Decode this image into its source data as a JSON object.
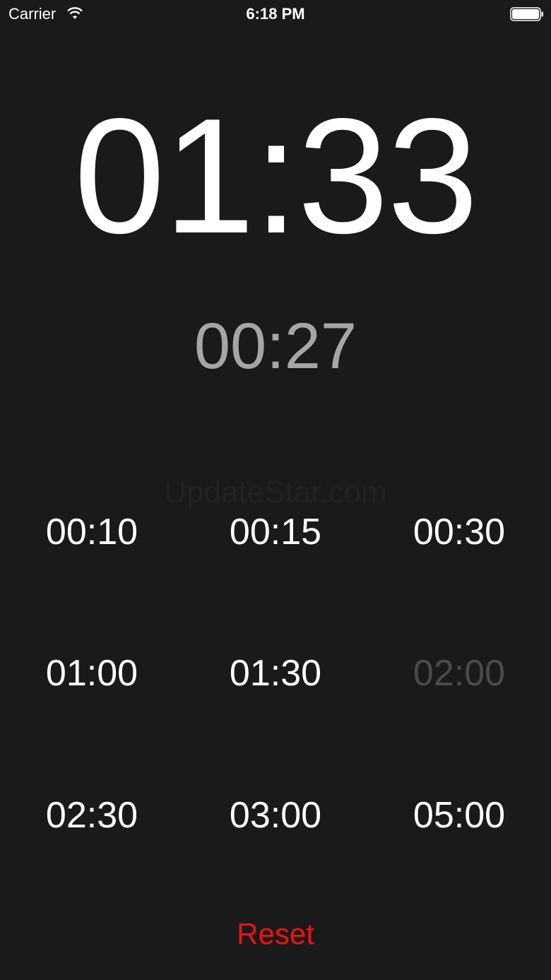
{
  "status_bar": {
    "carrier": "Carrier",
    "time": "6:18 PM"
  },
  "timer": {
    "elapsed": "01:33",
    "remaining": "00:27"
  },
  "watermark": "UpdateStar.com",
  "presets": [
    {
      "label": "00:10",
      "disabled": false
    },
    {
      "label": "00:15",
      "disabled": false
    },
    {
      "label": "00:30",
      "disabled": false
    },
    {
      "label": "01:00",
      "disabled": false
    },
    {
      "label": "01:30",
      "disabled": false
    },
    {
      "label": "02:00",
      "disabled": true
    },
    {
      "label": "02:30",
      "disabled": false
    },
    {
      "label": "03:00",
      "disabled": false
    },
    {
      "label": "05:00",
      "disabled": false
    }
  ],
  "reset_label": "Reset",
  "colors": {
    "background": "#1a1a1a",
    "primary_text": "#ffffff",
    "secondary_text": "#a6a6a6",
    "disabled_text": "#4a4a4a",
    "reset": "#ee1111"
  }
}
